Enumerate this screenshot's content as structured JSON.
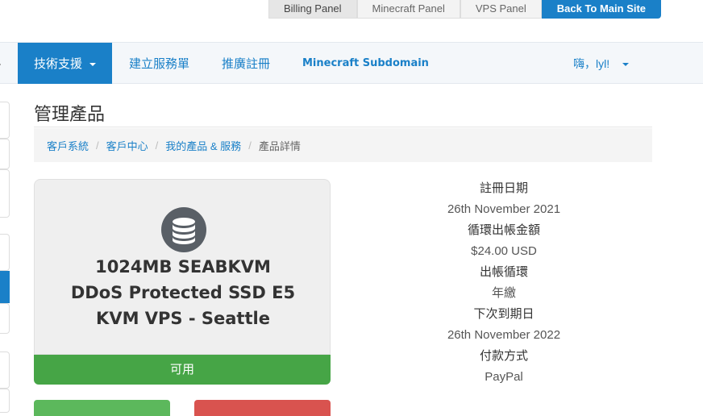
{
  "top_links": {
    "billing": "Billing Panel",
    "minecraft": "Minecraft Panel",
    "vps": "VPS Panel",
    "main_site": "Back To Main Site"
  },
  "navbar": {
    "support": "技術支援",
    "open_ticket": "建立服務單",
    "affiliates": "推廣註冊",
    "minecraft_subdomain": "Minecraft Subdomain",
    "greeting": "嗨，lyl!"
  },
  "page": {
    "title": "管理產品",
    "breadcrumb": [
      "客戶系統",
      "客戶中心",
      "我的產品 & 服務",
      "產品詳情"
    ]
  },
  "product": {
    "icon": "database-icon",
    "name_lines": [
      "1024MB SEABKVM",
      "DDoS Protected SSD E5",
      "KVM VPS - Seattle"
    ],
    "status": "可用"
  },
  "details": {
    "registration_date_label": "註冊日期",
    "registration_date": "26th November 2021",
    "recurring_amount_label": "循環出帳金額",
    "recurring_amount": "$24.00 USD",
    "billing_cycle_label": "出帳循環",
    "billing_cycle": "年繳",
    "next_due_date_label": "下次到期日",
    "next_due_date": "26th November 2022",
    "payment_method_label": "付款方式",
    "payment_method": "PayPal"
  },
  "colors": {
    "primary": "#1a80c8",
    "success": "#46a546",
    "danger": "#d9534f",
    "icon_bg": "#595f66"
  }
}
